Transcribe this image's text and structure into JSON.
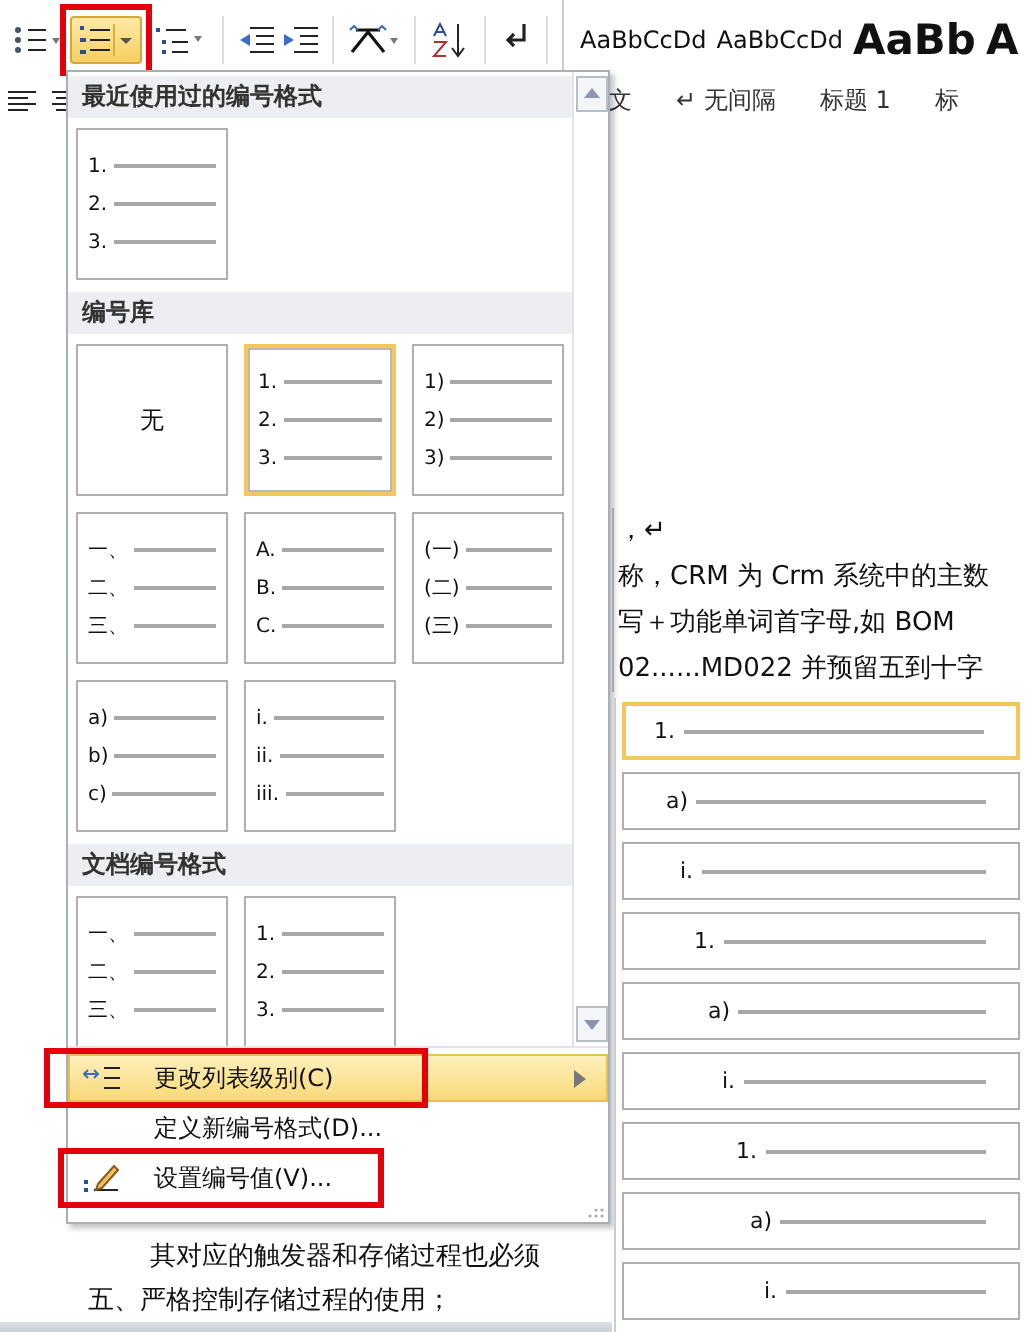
{
  "ribbon": {
    "numbering_button": {
      "highlighted": true
    },
    "styles": [
      {
        "sample": "AaBbCcDd",
        "kind": "normal"
      },
      {
        "sample": "AaBbCcDd",
        "kind": "normal"
      },
      {
        "sample": "AaBb",
        "kind": "heading"
      },
      {
        "sample": "A",
        "kind": "heading"
      }
    ],
    "style_labels": [
      "文",
      "↵ 无间隔",
      "标题 1",
      "标"
    ]
  },
  "document": {
    "lines_right": [
      "，↵",
      "称，CRM 为 Crm 系统中的主数",
      "写＋功能单词首字母,如 BOM",
      "02......MD022 并预留五到十字"
    ],
    "lines_bottom": [
      "其对应的触发器和存储过程也必须",
      "五、严格控制存储过程的使用；"
    ]
  },
  "numbering_menu": {
    "sections": [
      {
        "title": "最近使用过的编号格式",
        "tiles": [
          {
            "kind": "list",
            "markers": [
              "1.",
              "2.",
              "3."
            ],
            "selected": false
          }
        ]
      },
      {
        "title": "编号库",
        "tiles": [
          {
            "kind": "none",
            "label": "无",
            "selected": false
          },
          {
            "kind": "list",
            "markers": [
              "1.",
              "2.",
              "3."
            ],
            "selected": true
          },
          {
            "kind": "list",
            "markers": [
              "1)",
              "2)",
              "3)"
            ],
            "selected": false
          },
          {
            "kind": "list",
            "markers": [
              "一、",
              "二、",
              "三、"
            ],
            "selected": false
          },
          {
            "kind": "list",
            "markers": [
              "A.",
              "B.",
              "C."
            ],
            "selected": false
          },
          {
            "kind": "list",
            "markers": [
              "(一)",
              "(二)",
              "(三)"
            ],
            "selected": false
          },
          {
            "kind": "list",
            "markers": [
              "a)",
              "b)",
              "c)"
            ],
            "selected": false
          },
          {
            "kind": "list",
            "markers": [
              "i.",
              "ii.",
              "iii."
            ],
            "selected": false
          }
        ]
      },
      {
        "title": "文档编号格式",
        "tiles": [
          {
            "kind": "list",
            "markers": [
              "一、",
              "二、",
              "三、"
            ],
            "selected": false
          },
          {
            "kind": "list",
            "markers": [
              "1.",
              "2.",
              "3."
            ],
            "selected": false
          }
        ]
      }
    ],
    "items": [
      {
        "label": "更改列表级别(C)",
        "submenu": true,
        "selected": true,
        "highlighted": true
      },
      {
        "label": "定义新编号格式(D)...",
        "submenu": false,
        "selected": false,
        "highlighted": false
      },
      {
        "label": "设置编号值(V)...",
        "submenu": false,
        "selected": false,
        "highlighted": true
      }
    ]
  },
  "list_level_flyout": {
    "levels": [
      {
        "marker": "1.",
        "selected": true
      },
      {
        "marker": "a)",
        "selected": false
      },
      {
        "marker": "i.",
        "selected": false
      },
      {
        "marker": "1.",
        "selected": false
      },
      {
        "marker": "a)",
        "selected": false
      },
      {
        "marker": "i.",
        "selected": false
      },
      {
        "marker": "1.",
        "selected": false
      },
      {
        "marker": "a)",
        "selected": false
      },
      {
        "marker": "i.",
        "selected": false
      }
    ]
  }
}
